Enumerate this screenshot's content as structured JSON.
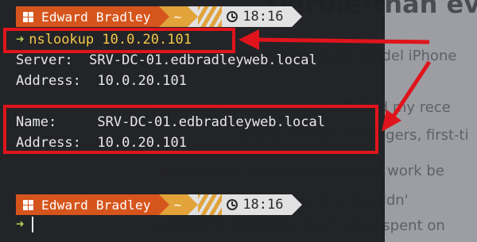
{
  "background_page": {
    "heading": "Derble-than ever",
    "lines": [
      "Unlock... Hmm ere the base model iPhone",
      "In recent years I mostly rell bted my rece",
      "phone to kids, teenagers, first-ti",
      "just needed a phone that would work be",
      "battery that wouldn'",
      "wanted to limit how much they spent on"
    ],
    "link_text": "iPhone"
  },
  "terminal": {
    "prompt1": {
      "user": "Edward Bradley",
      "path": "~",
      "time": "18:16",
      "os_icon": "windows-icon"
    },
    "command_caret": "➜",
    "command": "nslookup 10.0.20.101",
    "output": [
      {
        "label": "Server:",
        "value": "SRV-DC-01.edbradleyweb.local"
      },
      {
        "label": "Address:",
        "value": "10.0.20.101"
      },
      {
        "label": "Name:",
        "value": "SRV-DC-01.edbradleyweb.local"
      },
      {
        "label": "Address:",
        "value": "10.0.20.101"
      }
    ],
    "prompt2": {
      "user": "Edward Bradley",
      "path": "~",
      "time": "18:16",
      "os_icon": "windows-icon"
    },
    "final_caret": "➜"
  },
  "colors": {
    "terminal_bg": "#1f2023",
    "prompt_orange": "#d6551c",
    "prompt_amber": "#e1a33a",
    "prompt_light": "#e2e2e2",
    "command_yellow": "#f3c74a",
    "caret_green": "#b9cf58",
    "annotation_red": "#e0141c"
  }
}
